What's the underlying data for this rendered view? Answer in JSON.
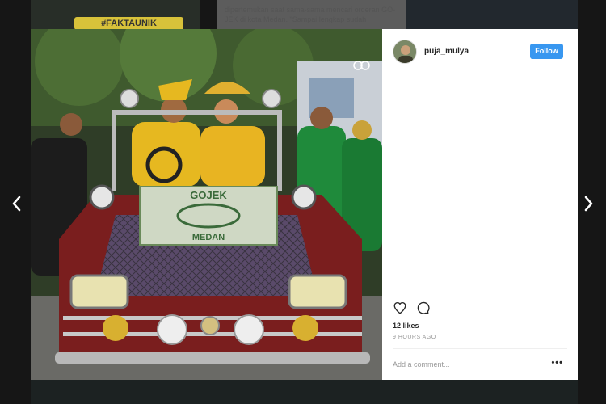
{
  "background": {
    "tag": "#FAKTAUNIK",
    "caption": "dipertemukan saat sama-sama mencari orderan GO-JEK di kota Medan. \"Sampai lengkap sudah"
  },
  "post": {
    "username": "puja_mulya",
    "follow_label": "Follow",
    "likes": "12 likes",
    "time": "9 HOURS AGO",
    "comment_placeholder": "Add a comment...",
    "more_label": "•••"
  },
  "photo": {
    "plate_top": "GOJEK",
    "plate_bottom": "MEDAN"
  },
  "icons": {
    "like": "heart-icon",
    "comment": "comment-icon",
    "more": "more-options-icon",
    "prev": "chevron-left-icon",
    "next": "chevron-right-icon"
  },
  "colors": {
    "follow_button": "#3897f0",
    "overlay": "#3b3b3b",
    "gojek_green": "#1f8a3b"
  }
}
